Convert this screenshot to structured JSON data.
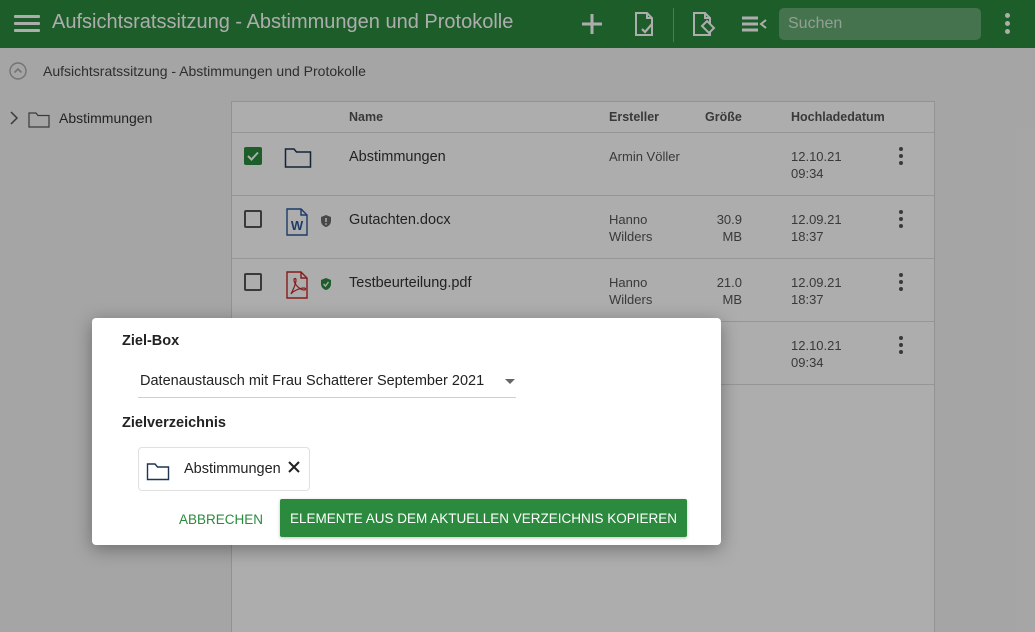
{
  "app": {
    "title": "Aufsichtsratssitzung - Abstimmungen und Protokolle",
    "search_placeholder": "Suchen"
  },
  "breadcrumb": {
    "text": "Aufsichtsratssitzung - Abstimmungen und Protokolle"
  },
  "tree": {
    "items": [
      {
        "label": "Abstimmungen"
      }
    ]
  },
  "table": {
    "columns": {
      "name": "Name",
      "creator": "Ersteller",
      "size": "Größe",
      "date": "Hochladedatum"
    },
    "rows": [
      {
        "type": "folder",
        "name": "Abstimmungen",
        "creator": "Armin Völler",
        "size": "",
        "date": "12.10.21\n09:34",
        "checked": true
      },
      {
        "type": "docx",
        "name": "Gutachten.docx",
        "creator": "Hanno\nWilders",
        "size": "30.9\nMB",
        "date": "12.09.21\n18:37",
        "checked": false,
        "shield": "#6a6a6a"
      },
      {
        "type": "pdf",
        "name": "Testbeurteilung.pdf",
        "creator": "Hanno\nWilders",
        "size": "21.0\nMB",
        "date": "12.09.21\n18:37",
        "checked": false,
        "shield": "#2b8a3e"
      },
      {
        "type": "hidden",
        "name": "",
        "creator": "",
        "size": "",
        "date": "12.10.21\n09:34",
        "checked": false
      }
    ]
  },
  "dialog": {
    "target_box_label": "Ziel-Box",
    "target_box_value": "Datenaustausch mit Frau Schatterer September 2021",
    "target_dir_label": "Zielverzeichnis",
    "target_dir_value": "Abstimmungen",
    "cancel_label": "ABBRECHEN",
    "copy_label": "ELEMENTE AUS DEM AKTUELLEN VERZEICHNIS KOPIEREN"
  },
  "colors": {
    "accent": "#2b8a3e",
    "pdf": "#c62828",
    "docx": "#2b579a",
    "folder_outline": "#1f3552"
  }
}
